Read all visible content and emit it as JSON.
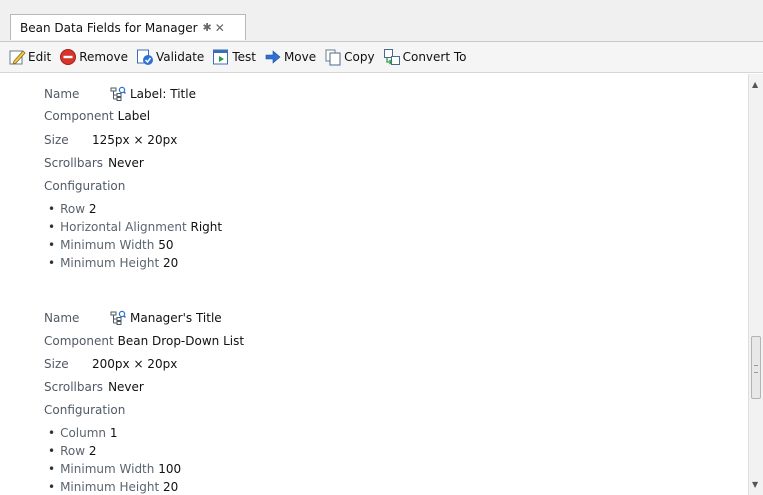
{
  "tab": {
    "title": "Bean Data Fields for Manager",
    "pin": "✱",
    "close": "✕"
  },
  "toolbar": {
    "edit": "Edit",
    "remove": "Remove",
    "validate": "Validate",
    "test": "Test",
    "move": "Move",
    "copy": "Copy",
    "convert": "Convert To"
  },
  "field_labels": {
    "name": "Name",
    "component": "Component",
    "size": "Size",
    "scrollbars": "Scrollbars",
    "configuration": "Configuration"
  },
  "fields": [
    {
      "name": "Label: Title",
      "component": "Label",
      "size": "125px × 20px",
      "scrollbars": "Never",
      "config": [
        {
          "key": "Row",
          "value": "2"
        },
        {
          "key": "Horizontal Alignment",
          "value": "Right"
        },
        {
          "key": "Minimum Width",
          "value": "50"
        },
        {
          "key": "Minimum Height",
          "value": "20"
        }
      ]
    },
    {
      "name": "Manager's Title",
      "component": "Bean Drop-Down List",
      "size": "200px × 20px",
      "scrollbars": "Never",
      "config": [
        {
          "key": "Column",
          "value": "1"
        },
        {
          "key": "Row",
          "value": "2"
        },
        {
          "key": "Minimum Width",
          "value": "100"
        },
        {
          "key": "Minimum Height",
          "value": "20"
        }
      ]
    }
  ],
  "icons": {
    "edit": "pencil-icon",
    "remove": "remove-icon",
    "validate": "validate-icon",
    "test": "test-icon",
    "move": "arrow-right-icon",
    "copy": "copy-icon",
    "convert": "convert-icon",
    "name": "tree-search-icon"
  },
  "colors": {
    "remove_red": "#d9342b",
    "move_blue": "#2f6fd6",
    "label_gray": "#505a66"
  }
}
